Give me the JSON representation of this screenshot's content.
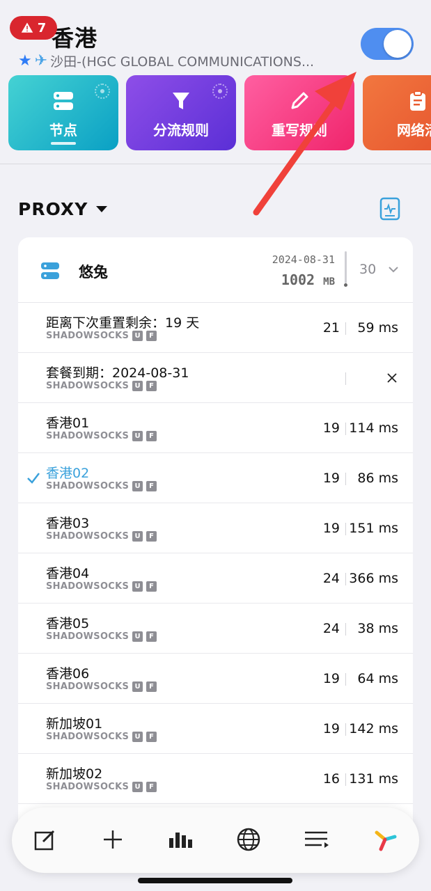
{
  "header": {
    "alert_count": "7",
    "title": "香港",
    "subtitle": "沙田-(HGC GLOBAL COMMUNICATIONS...",
    "star_icon": "star-icon",
    "plane_icon": "airplane-icon",
    "toggle_on": true,
    "accent": "#4f8ef0"
  },
  "tiles": [
    {
      "label": "节点",
      "icon": "server-icon",
      "color": "#12afc8"
    },
    {
      "label": "分流规则",
      "icon": "filter-icon",
      "color": "#6a35dd"
    },
    {
      "label": "重写规则",
      "icon": "pencil-icon",
      "color": "#f5357a"
    },
    {
      "label": "网络活",
      "icon": "clipboard-icon",
      "color": "#e95c31"
    }
  ],
  "section": {
    "title": "PROXY"
  },
  "group": {
    "name": "悠兔",
    "date": "2024-08-31",
    "size_value": "1002",
    "size_unit": "MB",
    "count": "30"
  },
  "nodes": [
    {
      "name": "距离下次重置剩余：19 天",
      "protocol": "SHADOWSOCKS",
      "tags": [
        "U",
        "F"
      ],
      "num": "21",
      "latency": "59 ms",
      "selected": false
    },
    {
      "name": "套餐到期：2024-08-31",
      "protocol": "SHADOWSOCKS",
      "tags": [
        "U",
        "F"
      ],
      "num": "",
      "latency": "",
      "selected": false
    },
    {
      "name": "香港01",
      "protocol": "SHADOWSOCKS",
      "tags": [
        "U",
        "F"
      ],
      "num": "19",
      "latency": "114 ms",
      "selected": false
    },
    {
      "name": "香港02",
      "protocol": "SHADOWSOCKS",
      "tags": [
        "U",
        "F"
      ],
      "num": "19",
      "latency": "86 ms",
      "selected": true
    },
    {
      "name": "香港03",
      "protocol": "SHADOWSOCKS",
      "tags": [
        "U",
        "F"
      ],
      "num": "19",
      "latency": "151 ms",
      "selected": false
    },
    {
      "name": "香港04",
      "protocol": "SHADOWSOCKS",
      "tags": [
        "U",
        "F"
      ],
      "num": "24",
      "latency": "366 ms",
      "selected": false
    },
    {
      "name": "香港05",
      "protocol": "SHADOWSOCKS",
      "tags": [
        "U",
        "F"
      ],
      "num": "24",
      "latency": "38 ms",
      "selected": false
    },
    {
      "name": "香港06",
      "protocol": "SHADOWSOCKS",
      "tags": [
        "U",
        "F"
      ],
      "num": "19",
      "latency": "64 ms",
      "selected": false
    },
    {
      "name": "新加坡01",
      "protocol": "SHADOWSOCKS",
      "tags": [
        "U",
        "F"
      ],
      "num": "19",
      "latency": "142 ms",
      "selected": false
    },
    {
      "name": "新加坡02",
      "protocol": "SHADOWSOCKS",
      "tags": [
        "U",
        "F"
      ],
      "num": "16",
      "latency": "131 ms",
      "selected": false
    }
  ],
  "tabbar": [
    {
      "icon": "edit-icon"
    },
    {
      "icon": "plus-icon"
    },
    {
      "icon": "bar-chart-icon"
    },
    {
      "icon": "globe-icon"
    },
    {
      "icon": "list-icon"
    },
    {
      "icon": "app-logo-icon"
    }
  ],
  "annotation": {
    "arrow_color": "#f0413a"
  }
}
